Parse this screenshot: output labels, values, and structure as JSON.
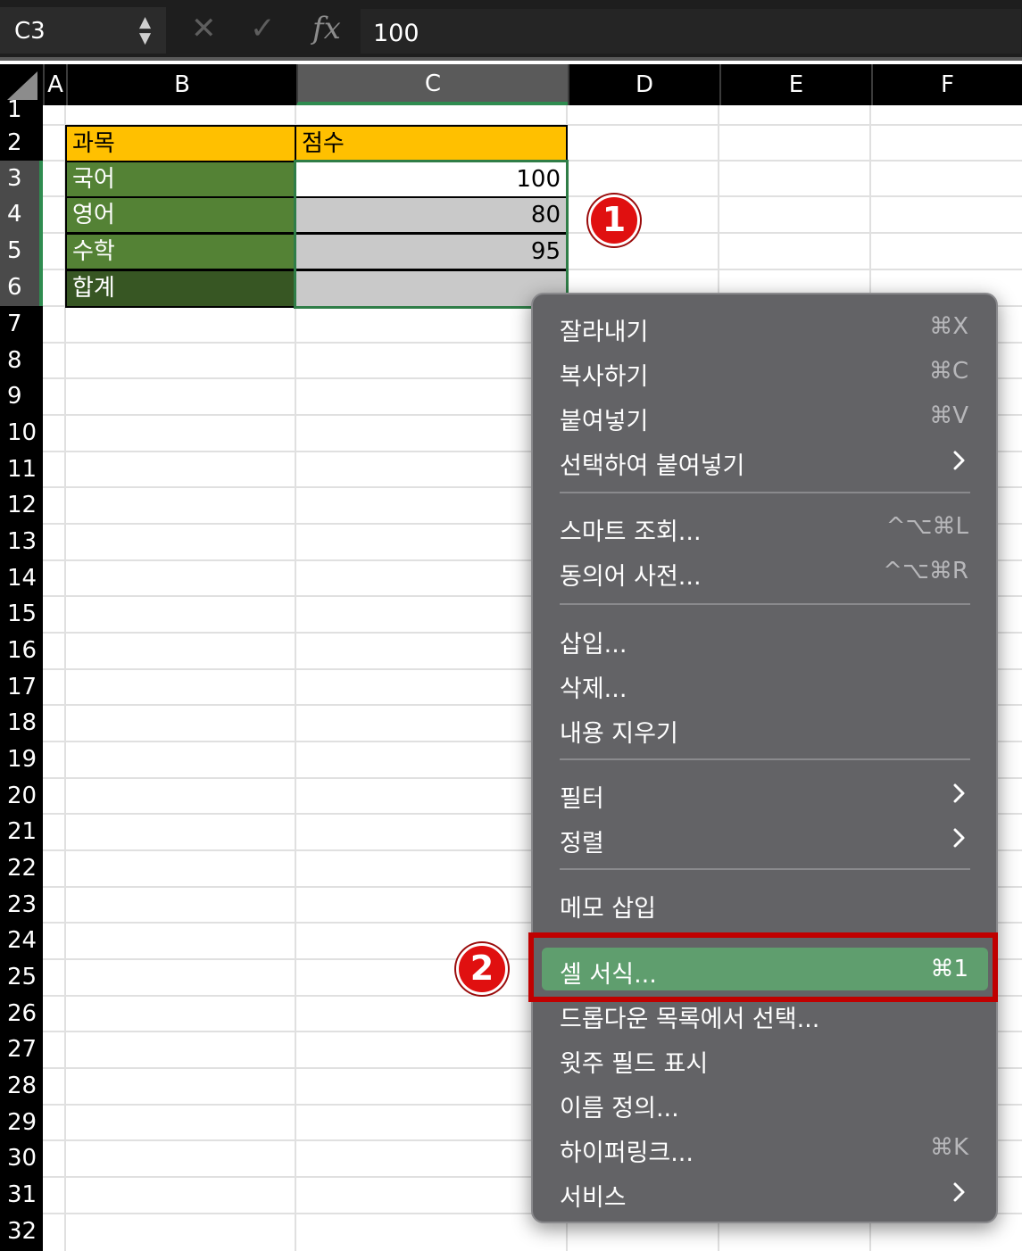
{
  "formula_bar": {
    "name_box": "C3",
    "stepper": "▲\n▼",
    "cancel_glyph": "✕",
    "enter_glyph": "✓",
    "fx_label": "fx",
    "formula_value": "100"
  },
  "columns": [
    "A",
    "B",
    "C",
    "D",
    "E",
    "F"
  ],
  "rows": [
    "1",
    "2",
    "3",
    "4",
    "5",
    "6",
    "7",
    "8",
    "9",
    "10",
    "11",
    "12",
    "13",
    "14",
    "15",
    "16",
    "17",
    "18",
    "19",
    "20",
    "21",
    "22",
    "23",
    "24",
    "25",
    "26",
    "27",
    "28",
    "29",
    "30",
    "31",
    "32"
  ],
  "table": {
    "header_subject": "과목",
    "header_score": "점수",
    "rows": [
      {
        "subject": "국어",
        "score": "100"
      },
      {
        "subject": "영어",
        "score": "80"
      },
      {
        "subject": "수학",
        "score": "95"
      },
      {
        "subject": "합계",
        "score": ""
      }
    ]
  },
  "annotations": {
    "step1": "1",
    "step2": "2"
  },
  "context_menu": {
    "groups": [
      [
        {
          "label": "잘라내기",
          "shortcut": "⌘X",
          "submenu": false
        },
        {
          "label": "복사하기",
          "shortcut": "⌘C",
          "submenu": false
        },
        {
          "label": "붙여넣기",
          "shortcut": "⌘V",
          "submenu": false
        },
        {
          "label": "선택하여 붙여넣기",
          "shortcut": "",
          "submenu": true
        }
      ],
      [
        {
          "label": "스마트 조회...",
          "shortcut": "^⌥⌘L",
          "submenu": false
        },
        {
          "label": "동의어 사전...",
          "shortcut": "^⌥⌘R",
          "submenu": false
        }
      ],
      [
        {
          "label": "삽입...",
          "shortcut": "",
          "submenu": false
        },
        {
          "label": "삭제...",
          "shortcut": "",
          "submenu": false
        },
        {
          "label": "내용 지우기",
          "shortcut": "",
          "submenu": false
        }
      ],
      [
        {
          "label": "필터",
          "shortcut": "",
          "submenu": true
        },
        {
          "label": "정렬",
          "shortcut": "",
          "submenu": true
        }
      ],
      [
        {
          "label": "메모 삽입",
          "shortcut": "",
          "submenu": false
        }
      ],
      [
        {
          "label": "셀 서식...",
          "shortcut": "⌘1",
          "submenu": false,
          "highlighted": true
        },
        {
          "label": "드롭다운 목록에서 선택...",
          "shortcut": "",
          "submenu": false
        },
        {
          "label": "윗주 필드 표시",
          "shortcut": "",
          "submenu": false
        },
        {
          "label": "이름 정의...",
          "shortcut": "",
          "submenu": false
        },
        {
          "label": "하이퍼링크...",
          "shortcut": "⌘K",
          "submenu": false
        },
        {
          "label": "서비스",
          "shortcut": "",
          "submenu": true
        }
      ]
    ]
  },
  "colors": {
    "header_fill": "#ffc000",
    "subject_fill": "#548235",
    "total_fill": "#375623",
    "score_fill": "#c9c9c9",
    "selection": "#2f7d47",
    "menu_bg": "#636366",
    "menu_highlight": "#5f9e6e",
    "annotation_red": "#e01010"
  }
}
